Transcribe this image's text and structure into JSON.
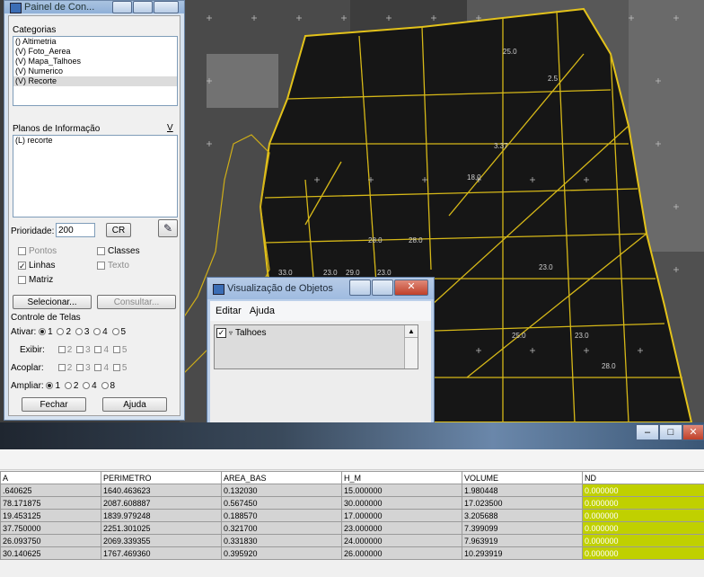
{
  "control_panel": {
    "title": "Painel de Con...",
    "categories_label": "Categorias",
    "categories": [
      "() Altimetria",
      "(V) Foto_Aerea",
      "(V) Mapa_Talhoes",
      "(V) Numerico",
      "(V) Recorte"
    ],
    "selected_category_index": 4,
    "planos_label": "Planos de Informação",
    "planos_button": "V",
    "planos": [
      "(L) recorte"
    ],
    "prioridade_label": "Prioridade:",
    "prioridade_value": "200",
    "cr_button": "CR",
    "checks": {
      "pontos": "Pontos",
      "classes": "Classes",
      "linhas": "Linhas",
      "texto": "Texto",
      "matriz": "Matriz"
    },
    "selecionar_button": "Selecionar...",
    "consultar_button": "Consultar...",
    "controle_label": "Controle de Telas",
    "ativar_label": "Ativar:",
    "exibir_label": "Exibir:",
    "acoplar_label": "Acoplar:",
    "ampliar_label": "Ampliar:",
    "n1": "1",
    "n2": "2",
    "n3": "3",
    "n4": "4",
    "n5": "5",
    "n8": "8",
    "fechar_button": "Fechar",
    "ajuda_button": "Ajuda"
  },
  "viz_window": {
    "title": "Visualização de Objetos",
    "menu": [
      "Editar",
      "Ajuda"
    ],
    "tree_item": "Talhoes"
  },
  "table": {
    "headers": [
      "A",
      "PERIMETRO",
      "AREA_BAS",
      "H_M",
      "VOLUME",
      "ND"
    ],
    "rows": [
      [
        ".640625",
        "1640.463623",
        "0.132030",
        "15.000000",
        "1.980448",
        "0.000000"
      ],
      [
        "78.171875",
        "2087.608887",
        "0.567450",
        "30.000000",
        "17.023500",
        "0.000000"
      ],
      [
        "19.453125",
        "1839.979248",
        "0.188570",
        "17.000000",
        "3.205688",
        "0.000000"
      ],
      [
        "37.750000",
        "2251.301025",
        "0.321700",
        "23.000000",
        "7.399099",
        "0.000000"
      ],
      [
        "26.093750",
        "2069.339355",
        "0.331830",
        "24.000000",
        "7.963919",
        "0.000000"
      ],
      [
        "30.140625",
        "1767.469360",
        "0.395920",
        "26.000000",
        "10.293919",
        "0.000000"
      ]
    ]
  },
  "map_labels": [
    "33.0",
    "23.0",
    "28.0",
    "29.0",
    "23.0",
    "2.5",
    "3.37",
    "28.0",
    "25.0",
    "23.0",
    "18.0",
    "23.0",
    "28.0",
    "25.0"
  ]
}
